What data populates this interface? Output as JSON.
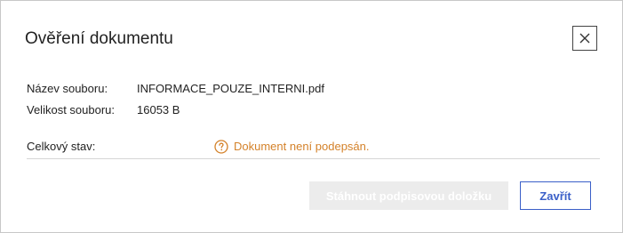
{
  "dialog": {
    "title": "Ověření dokumentu",
    "close_icon": "close-icon"
  },
  "file_info": {
    "name_label": "Název souboru:",
    "name_value": "INFORMACE_POUZE_INTERNI.pdf",
    "size_label": "Velikost souboru:",
    "size_value": "16053 B"
  },
  "status": {
    "label": "Celkový stav:",
    "icon": "question-circle-icon",
    "text": "Dokument není podepsán.",
    "color": "#d4822a"
  },
  "buttons": {
    "download_label": "Stáhnout podpisovou doložku",
    "download_disabled": true,
    "close_label": "Zavřít",
    "accent_color": "#3a5fc8"
  }
}
